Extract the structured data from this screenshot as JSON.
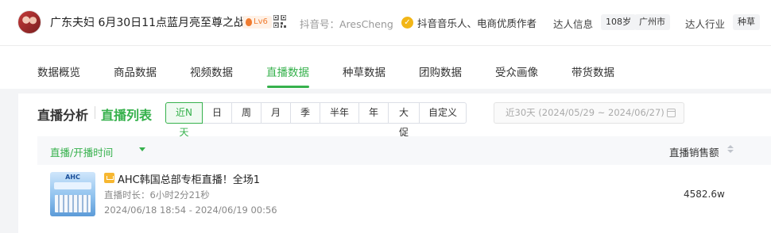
{
  "header": {
    "name": "广东夫妇 6月30日11点蓝月亮至尊之战",
    "level": "Lv6",
    "douyin_id": "抖音号：AresCheng",
    "verification": "抖音音乐人、电商优质作者",
    "talent_info_label": "达人信息",
    "age": "108岁",
    "city": "广州市",
    "industry_label": "达人行业",
    "industry": "种草"
  },
  "tabs": [
    {
      "label": "数据概览",
      "active": false
    },
    {
      "label": "商品数据",
      "active": false
    },
    {
      "label": "视频数据",
      "active": false
    },
    {
      "label": "直播数据",
      "active": true
    },
    {
      "label": "种草数据",
      "active": false
    },
    {
      "label": "团购数据",
      "active": false
    },
    {
      "label": "受众画像",
      "active": false
    },
    {
      "label": "带货数据",
      "active": false
    }
  ],
  "section": {
    "title": "直播分析",
    "subtitle": "直播列表"
  },
  "range_buttons": [
    {
      "label": "近N天",
      "active": true
    },
    {
      "label": "日",
      "active": false
    },
    {
      "label": "周",
      "active": false
    },
    {
      "label": "月",
      "active": false
    },
    {
      "label": "季",
      "active": false
    },
    {
      "label": "半年",
      "active": false
    },
    {
      "label": "年",
      "active": false
    },
    {
      "label": "大促",
      "active": false
    },
    {
      "label": "自定义",
      "active": false
    }
  ],
  "date_range": "近30天 (2024/05/29 ~ 2024/06/27)",
  "table": {
    "col_live": "直播/开播时间",
    "col_sales": "直播销售额",
    "rows": [
      {
        "cover_text": "AHC",
        "title": "AHC韩国总部专柜直播！全场1",
        "duration": "直播时长：6小时2分21秒",
        "time": "2024/06/18 18:54 - 2024/06/19 00:56",
        "sales": "4582.6w"
      }
    ]
  },
  "colors": {
    "accent": "#36b14c",
    "level_badge": "#f07b2f",
    "verify": "#f2b617"
  }
}
